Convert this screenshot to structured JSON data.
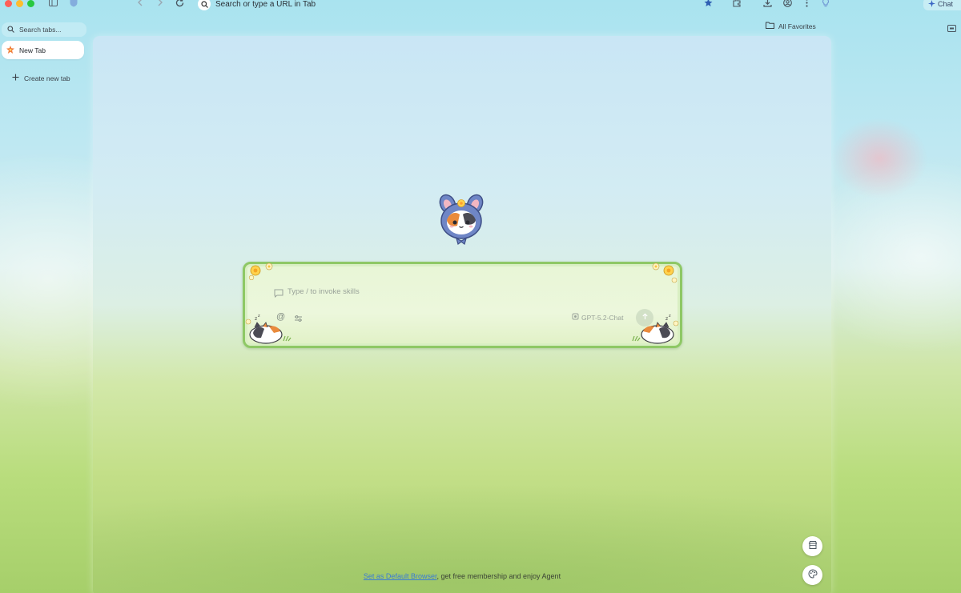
{
  "window": {
    "traffic_lights": [
      "close",
      "minimize",
      "maximize"
    ]
  },
  "toolbar": {
    "url_placeholder": "Search or type a URL in Tab",
    "chat_label": "Chat",
    "icons": [
      "sidebar-icon",
      "shield-icon",
      "back-icon",
      "forward-icon",
      "reload-icon",
      "search-icon",
      "star-icon",
      "extensions-icon",
      "download-icon",
      "profile-icon",
      "more-icon",
      "lightbulb-icon",
      "sparkle-icon"
    ]
  },
  "favorites": {
    "label": "All Favorites"
  },
  "sidebar": {
    "search_placeholder": "Search tabs...",
    "tabs": [
      {
        "label": "New Tab",
        "active": true
      }
    ],
    "create_label": "Create new tab"
  },
  "newtab": {
    "input_placeholder": "Type / to invoke skills",
    "model": "GPT-5.2-Chat",
    "at_symbol": "@",
    "footer_link": "Set as Default Browser",
    "footer_text": ", get free membership and enjoy Agent"
  },
  "colors": {
    "accent_green": "#8ec865",
    "link_blue": "#3a7bd5"
  }
}
